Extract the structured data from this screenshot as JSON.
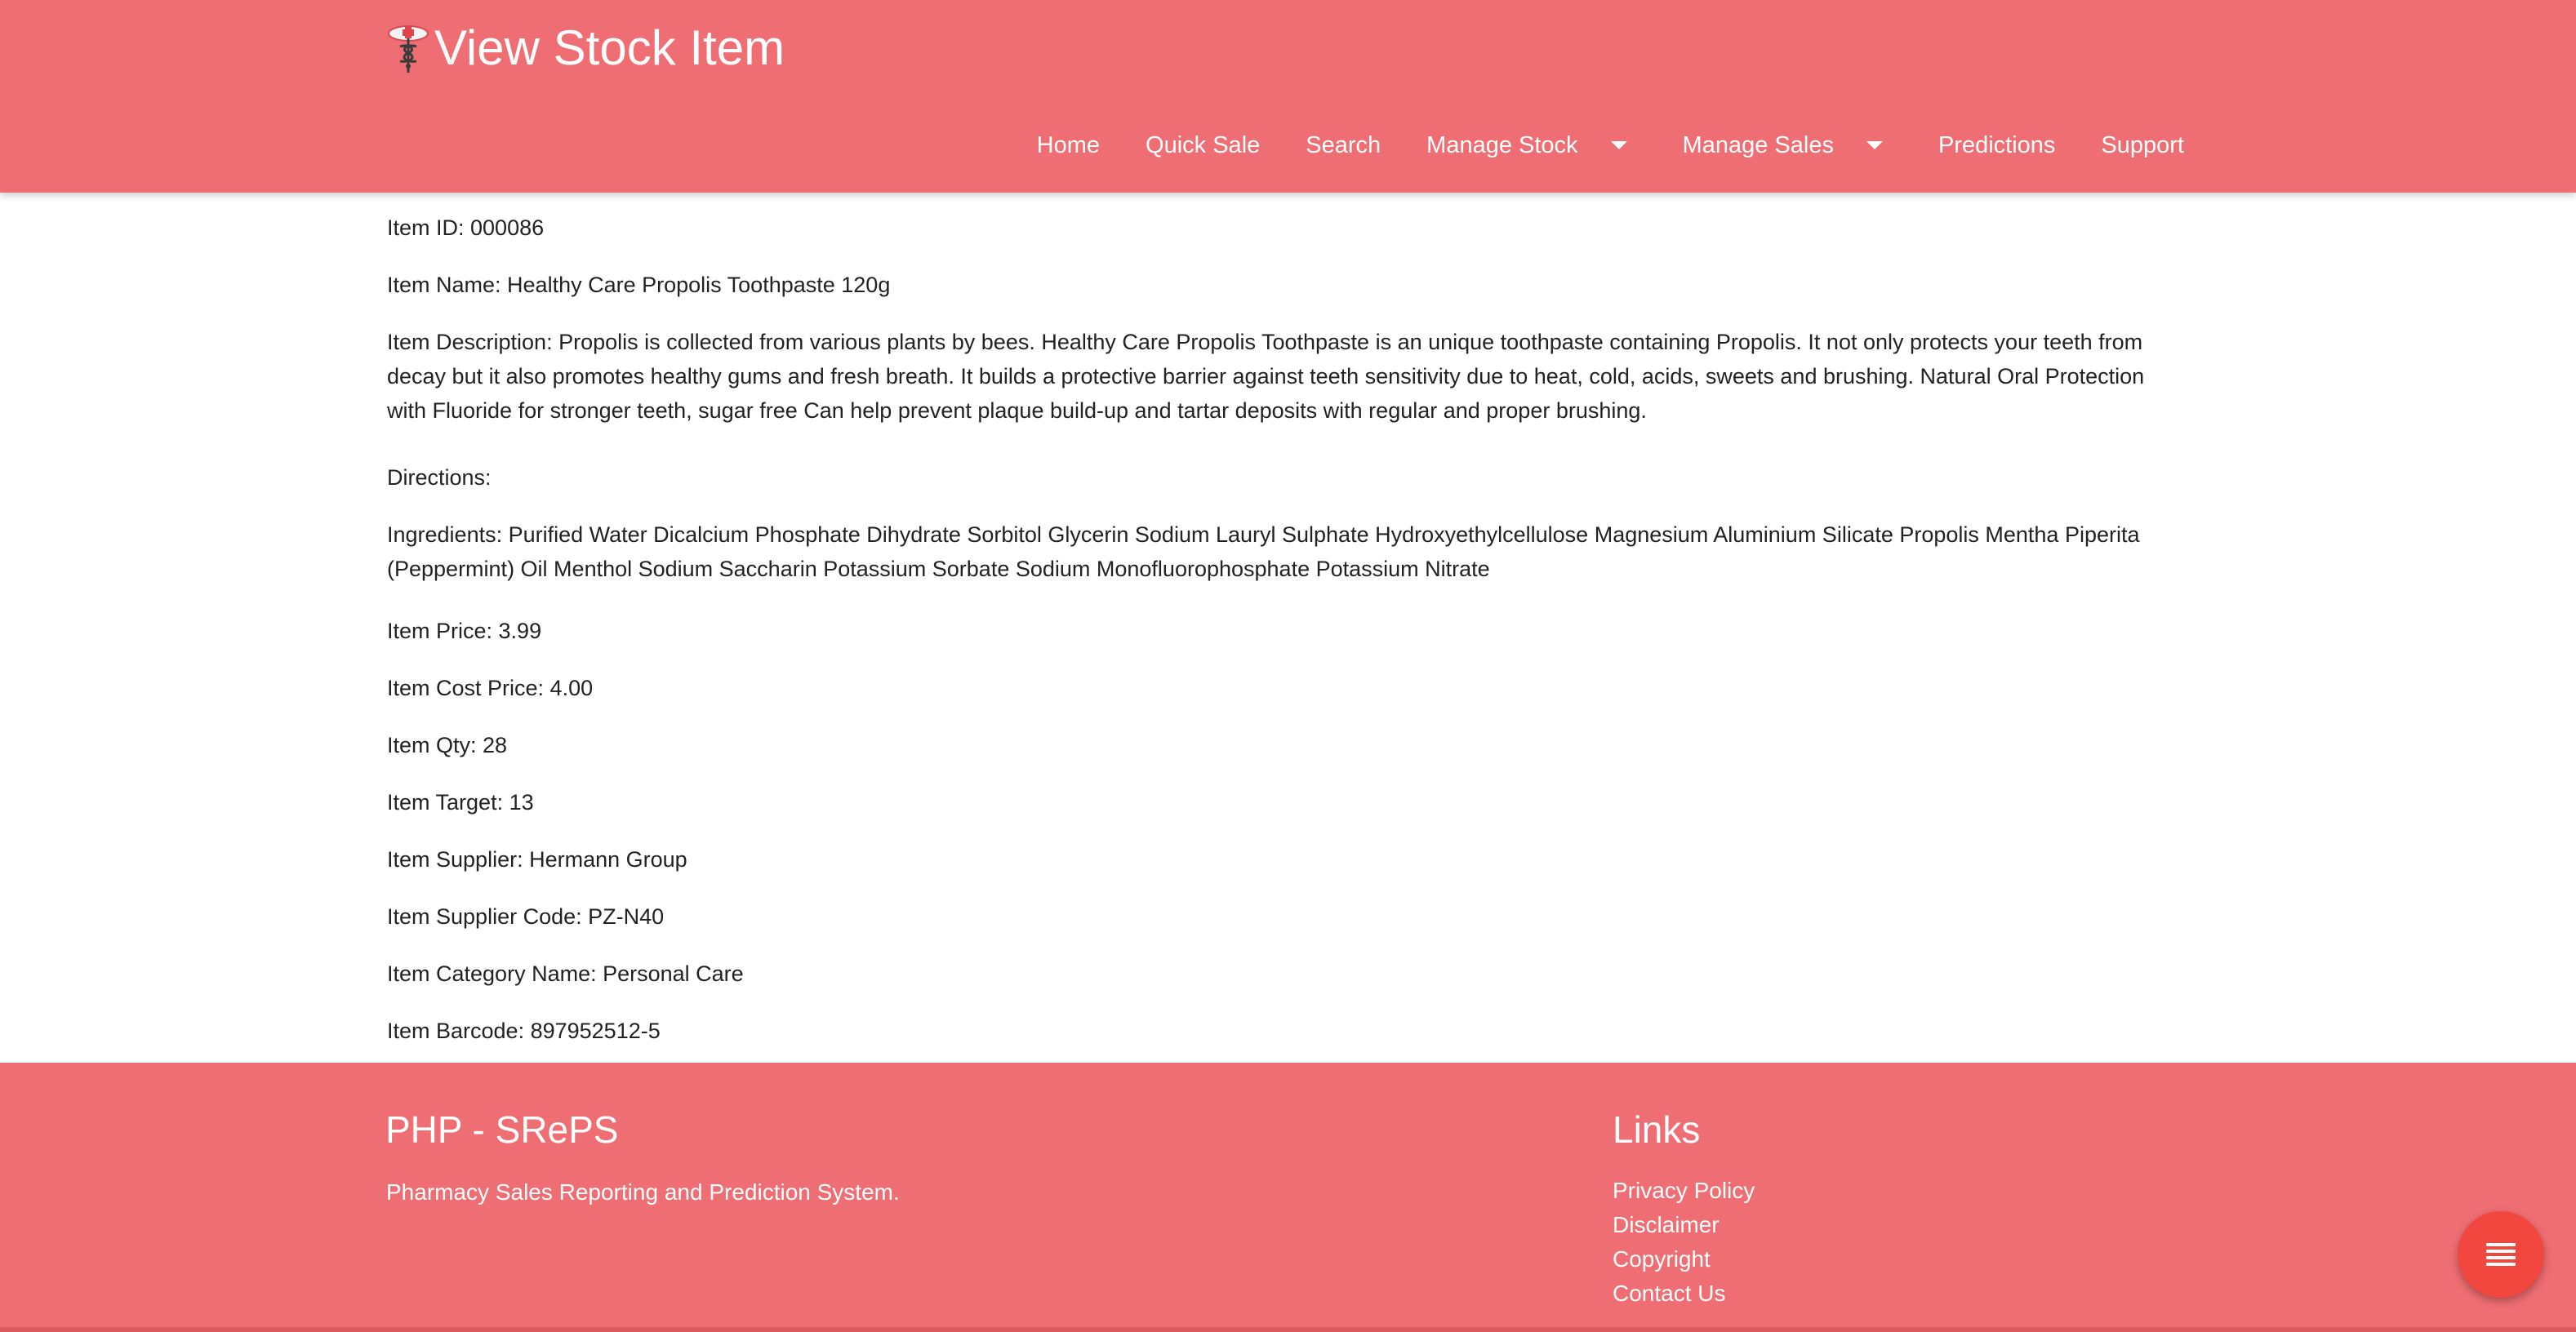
{
  "header": {
    "title": "View Stock Item",
    "logo_icon": "caduceus-icon",
    "nav": {
      "home": "Home",
      "quick_sale": "Quick Sale",
      "search": "Search",
      "manage_stock": "Manage Stock",
      "manage_sales": "Manage Sales",
      "predictions": "Predictions",
      "support": "Support"
    }
  },
  "item": {
    "id": "Item ID: 000086",
    "name": "Item Name: Healthy Care Propolis Toothpaste 120g",
    "description": "Item Description: Propolis is collected from various plants by bees. Healthy Care Propolis Toothpaste is an unique toothpaste containing Propolis. It not only protects your teeth from decay but it also promotes healthy gums and fresh breath. It builds a protective barrier against teeth sensitivity due to heat, cold, acids, sweets and brushing. Natural Oral Protection with Fluoride for stronger teeth, sugar free Can help prevent plaque build-up and tartar deposits with regular and proper brushing.",
    "directions": "Directions:",
    "ingredients": "Ingredients: Purified Water Dicalcium Phosphate Dihydrate Sorbitol Glycerin Sodium Lauryl Sulphate Hydroxyethylcellulose Magnesium Aluminium Silicate Propolis Mentha Piperita (Peppermint) Oil Menthol Sodium Saccharin Potassium Sorbate Sodium Monofluorophosphate Potassium Nitrate",
    "price": "Item Price: 3.99",
    "cost_price": "Item Cost Price: 4.00",
    "qty": "Item Qty: 28",
    "target": "Item Target: 13",
    "supplier": "Item Supplier: Hermann Group",
    "supplier_code": "Item Supplier Code: PZ-N40",
    "category": "Item Category Name: Personal Care",
    "barcode": "Item Barcode: 897952512-5"
  },
  "footer": {
    "app_title": "PHP - SRePS",
    "app_subtitle": "Pharmacy Sales Reporting and Prediction System.",
    "links_title": "Links",
    "links": [
      "Privacy Policy",
      "Disclaimer",
      "Copyright",
      "Contact Us"
    ]
  },
  "fab": {
    "icon": "menu-icon"
  },
  "colors": {
    "primary": "#ef6e73",
    "fab": "#f2473f"
  }
}
